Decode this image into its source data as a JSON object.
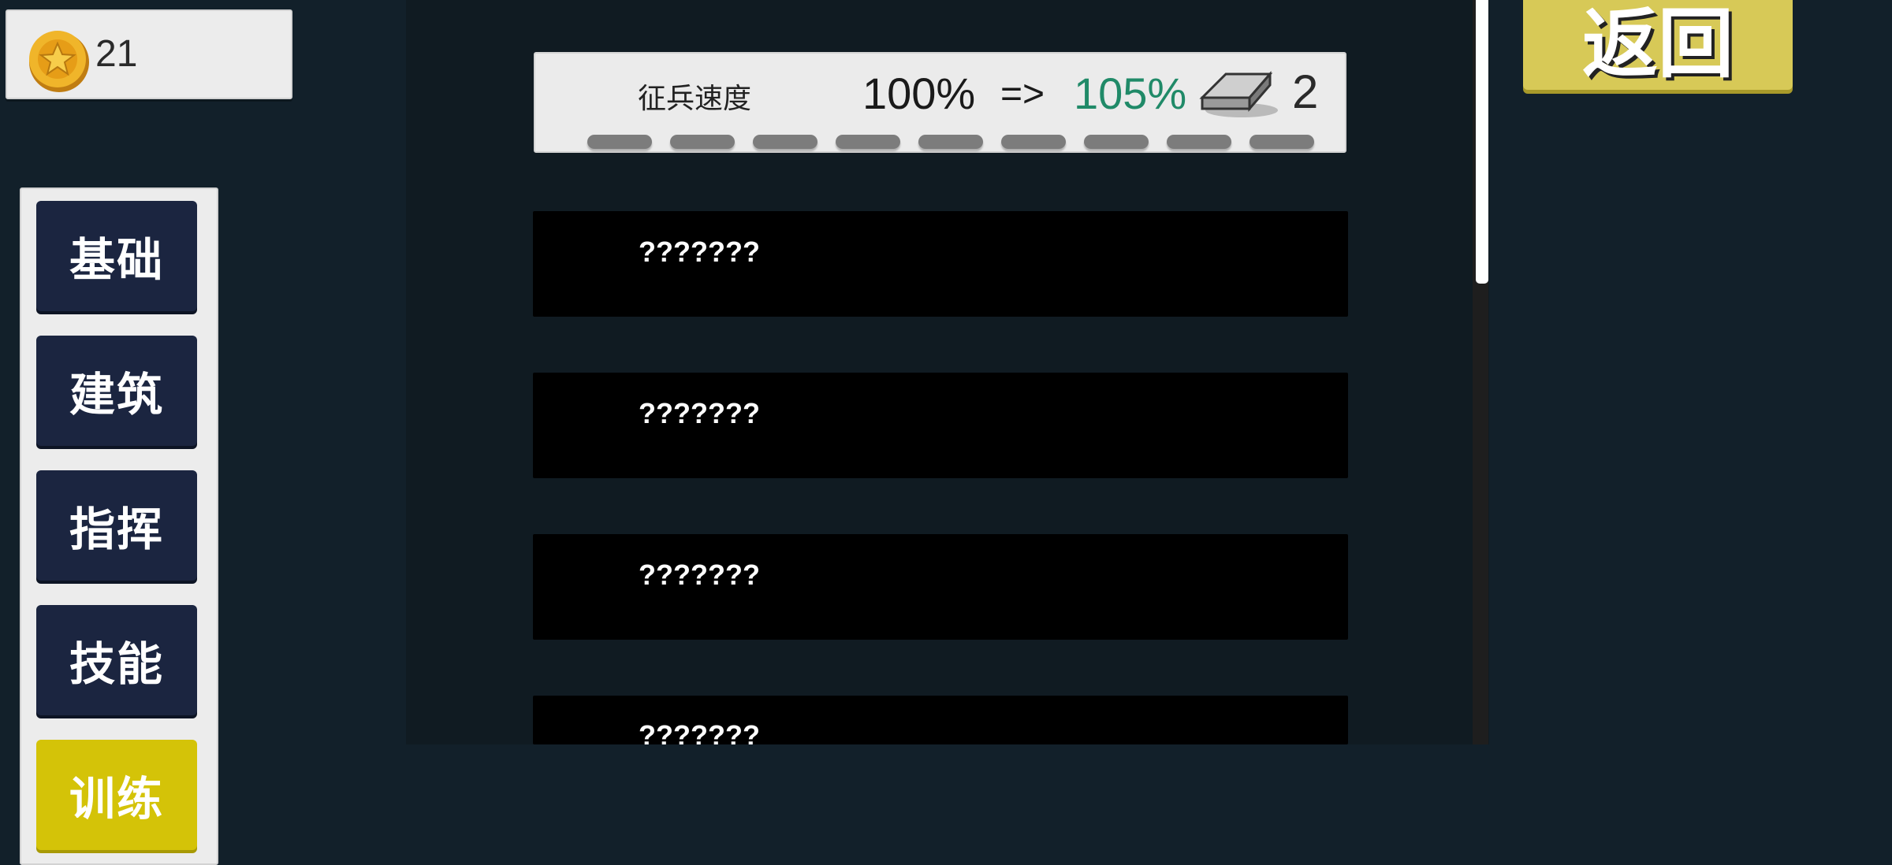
{
  "currency": {
    "coins": "21",
    "coin_icon": "coin-icon",
    "coin_color": "#f0b52a"
  },
  "sidebar": {
    "items": [
      {
        "label": "基础",
        "active": false
      },
      {
        "label": "建筑",
        "active": false
      },
      {
        "label": "指挥",
        "active": false
      },
      {
        "label": "技能",
        "active": false
      },
      {
        "label": "训练",
        "active": true
      }
    ],
    "active_color": "#d4c308",
    "inactive_color": "#1b2540"
  },
  "upgrade": {
    "label": "征兵速度",
    "from": "100%",
    "arrow": "=>",
    "to": "105%",
    "to_color": "#208a68",
    "cost": "2",
    "cost_icon": "iron-ingot-icon",
    "level_segments": 9
  },
  "rows": [
    {
      "label": "???????"
    },
    {
      "label": "???????"
    },
    {
      "label": "???????"
    },
    {
      "label": "???????"
    }
  ],
  "back_button": {
    "label": "返回",
    "color": "#d7c957"
  }
}
